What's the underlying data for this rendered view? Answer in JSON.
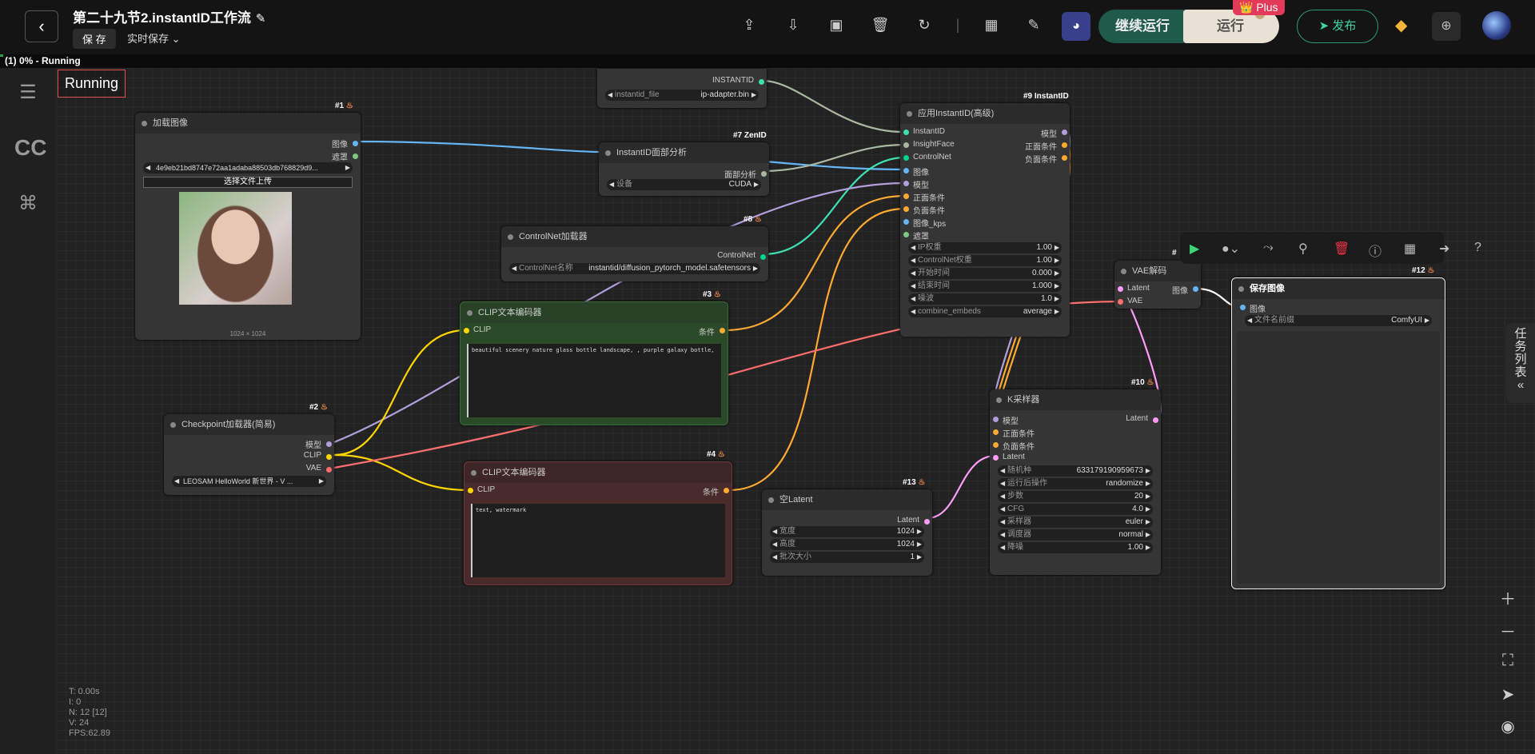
{
  "header": {
    "back_icon": "‹",
    "title": "第二十九节2.instantID工作流",
    "edit_icon": "✎",
    "save_label": "保 存",
    "realtime_save": "实时保存",
    "continue_run": "继续运行",
    "run": "运行",
    "plus_badge": "👑 Plus",
    "publish": "发布"
  },
  "status": {
    "progress_text": "(1) 0% - Running",
    "progress_fraction": 0.0
  },
  "running_label": "Running",
  "nodes": {
    "n1": {
      "id": "#1",
      "title": "加载图像",
      "out_image": "图像",
      "out_mask": "遮罩",
      "file": "4e9eb21bd8747e72aa1adaba88503db768829d9...",
      "upload": "选择文件上传",
      "img_size": "1024 × 1024"
    },
    "instantid_loader": {
      "out": "INSTANTID",
      "w_label": "instantid_file",
      "w_val": "ip-adapter.bin"
    },
    "n7": {
      "id": "#7 ZenID",
      "title": "InstantID面部分析",
      "out": "面部分析",
      "w_label": "设备",
      "w_val": "CUDA"
    },
    "n8": {
      "id": "#8",
      "title": "ControlNet加载器",
      "out": "ControlNet",
      "w_label": "ControlNet名称",
      "w_val": "instantid/diffusion_pytorch_model.safetensors"
    },
    "n3": {
      "id": "#3",
      "title": "CLIP文本编码器",
      "in": "CLIP",
      "out": "条件",
      "text": "beautiful scenery nature glass bottle landscape, , purple galaxy bottle,"
    },
    "n2": {
      "id": "#2",
      "title": "Checkpoint加载器(简易)",
      "out_model": "模型",
      "out_clip": "CLIP",
      "out_vae": "VAE",
      "ckpt": "LEOSAM HelloWorld 新世界 - V ..."
    },
    "n4": {
      "id": "#4",
      "title": "CLIP文本编码器",
      "in": "CLIP",
      "out": "条件",
      "text": "text, watermark"
    },
    "n9": {
      "id": "#9 InstantID",
      "title": "应用InstantID(高级)",
      "inputs": [
        "InstantID",
        "InsightFace",
        "ControlNet",
        "图像",
        "模型",
        "正面条件",
        "负面条件",
        "图像_kps",
        "遮罩"
      ],
      "outputs": [
        "模型",
        "正面条件",
        "负面条件"
      ],
      "widgets": [
        {
          "l": "IP权重",
          "v": "1.00"
        },
        {
          "l": "ControlNet权重",
          "v": "1.00"
        },
        {
          "l": "开始时间",
          "v": "0.000"
        },
        {
          "l": "结束时间",
          "v": "1.000"
        },
        {
          "l": "噪波",
          "v": "1.0"
        },
        {
          "l": "combine_embeds",
          "v": "average"
        }
      ]
    },
    "vae": {
      "title": "VAE解码",
      "in_latent": "Latent",
      "in_vae": "VAE",
      "out": "图像",
      "id": "#"
    },
    "n12": {
      "id": "#12",
      "title": "保存图像",
      "in": "图像",
      "w_label": "文件名前缀",
      "w_val": "ComfyUI"
    },
    "n10": {
      "id": "#10",
      "title": "K采样器",
      "inputs": [
        "模型",
        "正面条件",
        "负面条件",
        "Latent"
      ],
      "out": "Latent",
      "widgets": [
        {
          "l": "随机种",
          "v": "633179190959673"
        },
        {
          "l": "运行后操作",
          "v": "randomize"
        },
        {
          "l": "步数",
          "v": "20"
        },
        {
          "l": "CFG",
          "v": "4.0"
        },
        {
          "l": "采样器",
          "v": "euler"
        },
        {
          "l": "调度器",
          "v": "normal"
        },
        {
          "l": "降噪",
          "v": "1.00"
        }
      ]
    },
    "n13": {
      "id": "#13",
      "title": "空Latent",
      "out": "Latent",
      "widgets": [
        {
          "l": "宽度",
          "v": "1024"
        },
        {
          "l": "高度",
          "v": "1024"
        },
        {
          "l": "批次大小",
          "v": "1"
        }
      ]
    }
  },
  "right_panel": {
    "label": "任务列表",
    "collapse_icon": "«"
  },
  "stats": {
    "t": "T: 0.00s",
    "i": "I: 0",
    "n": "N: 12 [12]",
    "v": "V: 24",
    "fps": "FPS:62.89"
  },
  "colors": {
    "clip": "#ffd500",
    "model": "#b39ddb",
    "vae": "#ff6e6e",
    "cond": "#ffa931",
    "image": "#64b5f6",
    "latent": "#ff9cf9",
    "controlnet": "#00d78d",
    "canvas": "#222222"
  }
}
